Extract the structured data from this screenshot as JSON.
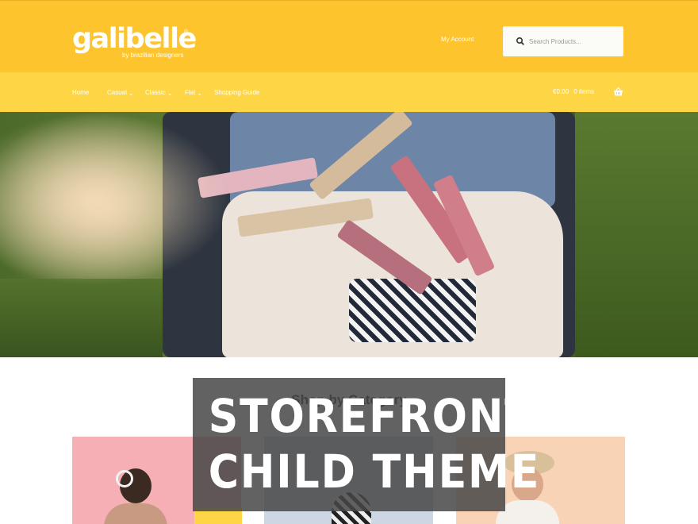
{
  "brand": {
    "logo_text": "galibelle",
    "logo_mark": "®",
    "tagline": "by brazilian designers"
  },
  "header": {
    "my_account": "My Account",
    "search_placeholder": "Search Products..."
  },
  "nav": {
    "items": [
      {
        "label": "Home",
        "dropdown": false
      },
      {
        "label": "Casual",
        "dropdown": true
      },
      {
        "label": "Classic",
        "dropdown": true
      },
      {
        "label": "Flat",
        "dropdown": true
      },
      {
        "label": "Shopping Guide",
        "dropdown": false
      }
    ],
    "cart_amount": "€0.00",
    "cart_items": "0 items"
  },
  "section": {
    "title": "Shop by Category"
  },
  "overlay": {
    "line1": "STOREFRONT",
    "line2": "CHILD THEME"
  },
  "colors": {
    "header_yellow": "#fdc42d",
    "nav_yellow": "#fed645",
    "banner_gray": "#464646"
  }
}
